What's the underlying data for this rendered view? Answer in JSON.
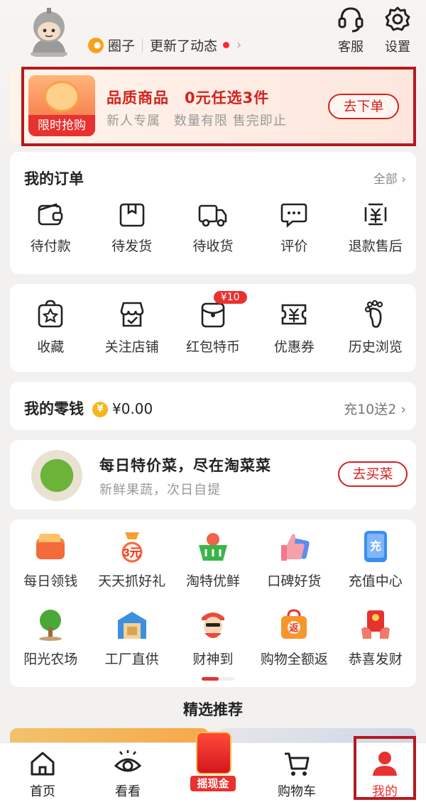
{
  "header": {
    "quanzi_label": "圈子",
    "update_text": "更新了动态",
    "service_label": "客服",
    "settings_label": "设置"
  },
  "promo": {
    "tag": "限时抢购",
    "title": "品质商品　0元任选3件",
    "subtitle": "新人专属　数量有限 售完即止",
    "button": "去下单"
  },
  "orders": {
    "title": "我的订单",
    "all_label": "全部",
    "items": [
      {
        "label": "待付款",
        "icon": "wallet-icon"
      },
      {
        "label": "待发货",
        "icon": "package-icon"
      },
      {
        "label": "待收货",
        "icon": "truck-icon"
      },
      {
        "label": "评价",
        "icon": "comment-icon"
      },
      {
        "label": "退款售后",
        "icon": "refund-icon"
      }
    ]
  },
  "shortcuts": {
    "items": [
      {
        "label": "收藏",
        "icon": "star-bag-icon"
      },
      {
        "label": "关注店铺",
        "icon": "store-icon"
      },
      {
        "label": "红包特币",
        "icon": "red-packet-icon",
        "badge": "¥10"
      },
      {
        "label": "优惠券",
        "icon": "coupon-icon"
      },
      {
        "label": "历史浏览",
        "icon": "footprint-icon"
      }
    ]
  },
  "wallet": {
    "title": "我的零钱",
    "coin_symbol": "¥",
    "amount": "¥0.00",
    "promo": "充10送2"
  },
  "veg": {
    "title": "每日特价菜，尽在淘菜菜",
    "subtitle": "新鲜果蔬，次日自提",
    "button": "去买菜"
  },
  "services": {
    "row1": [
      {
        "label": "每日领钱",
        "icon": "wallet-gift-icon",
        "color": "#f08a4b"
      },
      {
        "label": "天天抓好礼",
        "icon": "claw-icon",
        "color": "#f7a032",
        "mark": "3元"
      },
      {
        "label": "淘特优鲜",
        "icon": "basket-icon",
        "color": "#3bb54a"
      },
      {
        "label": "口碑好货",
        "icon": "thumb-icon",
        "color": "#f27a8a"
      },
      {
        "label": "充值中心",
        "icon": "phone-icon",
        "color": "#3a8ef0",
        "mark": "充"
      }
    ],
    "row2": [
      {
        "label": "阳光农场",
        "icon": "tree-icon",
        "color": "#4aa838"
      },
      {
        "label": "工厂直供",
        "icon": "warehouse-icon",
        "color": "#3d8fe0"
      },
      {
        "label": "财神到",
        "icon": "god-of-wealth-icon",
        "color": "#e84b3a"
      },
      {
        "label": "购物全额返",
        "icon": "return-bag-icon",
        "color": "#f7962c",
        "mark": "返"
      },
      {
        "label": "恭喜发财",
        "icon": "gift-hands-icon",
        "color": "#e8322f"
      }
    ]
  },
  "recommend": {
    "title": "精选推荐"
  },
  "nav": {
    "home": "首页",
    "watch": "看看",
    "cash": "摇现金",
    "cart": "购物车",
    "mine": "我的"
  }
}
